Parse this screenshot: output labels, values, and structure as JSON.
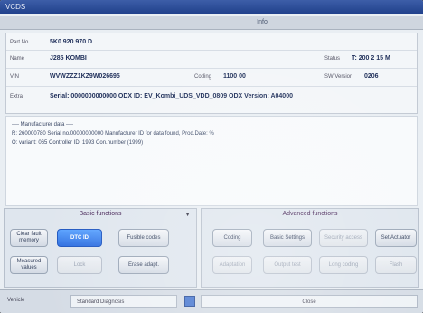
{
  "window": {
    "title": "VCDS"
  },
  "infobar": {
    "title": "Info"
  },
  "info": {
    "part_no_label": "Part No.",
    "part_no": "5K0 920 970 D",
    "name_label": "Name",
    "name": "J285  KOMBI",
    "status_label": "Status",
    "status": "T: 200 2 15 M",
    "vin_label": "VIN",
    "vin": "WVWZZZ1KZ9W026695",
    "coding_label": "Coding",
    "coding": "1100 00",
    "sw_version_label": "SW Version",
    "sw_version": "0206",
    "extra_label": "Extra",
    "extra": "Serial: 0000000000000 ODX ID: EV_Kombi_UDS_VDD_0809 ODX Version: A04000"
  },
  "messages": [
    "---- Manufacturer data ----",
    "R: 260000780 Serial no.00000000000 Manufacturer ID for data found, Prod.Date: %",
    "O: variant: 065 Controller ID: 1993 Con.number (1999)"
  ],
  "basic_panel": {
    "header": "Basic functions",
    "buttons": {
      "fault_memory": "Clear fault memory",
      "dtc": "DTC ID",
      "ecu_list": "Fusible codes",
      "measured": "Measured values",
      "lock": "Lock",
      "status": "Erase adapt."
    }
  },
  "advanced_panel": {
    "header": "Advanced functions",
    "buttons": {
      "coding": "Coding",
      "basic_settings": "Basic Settings",
      "security": "Security access",
      "actuator": "Set Actuator",
      "b5": "Adaptation",
      "b6": "Output test",
      "b7": "Long coding",
      "b8": "Flash"
    }
  },
  "bottombar": {
    "label": "Vehicle",
    "field": "Standard Diagnosis",
    "status": "Close"
  }
}
